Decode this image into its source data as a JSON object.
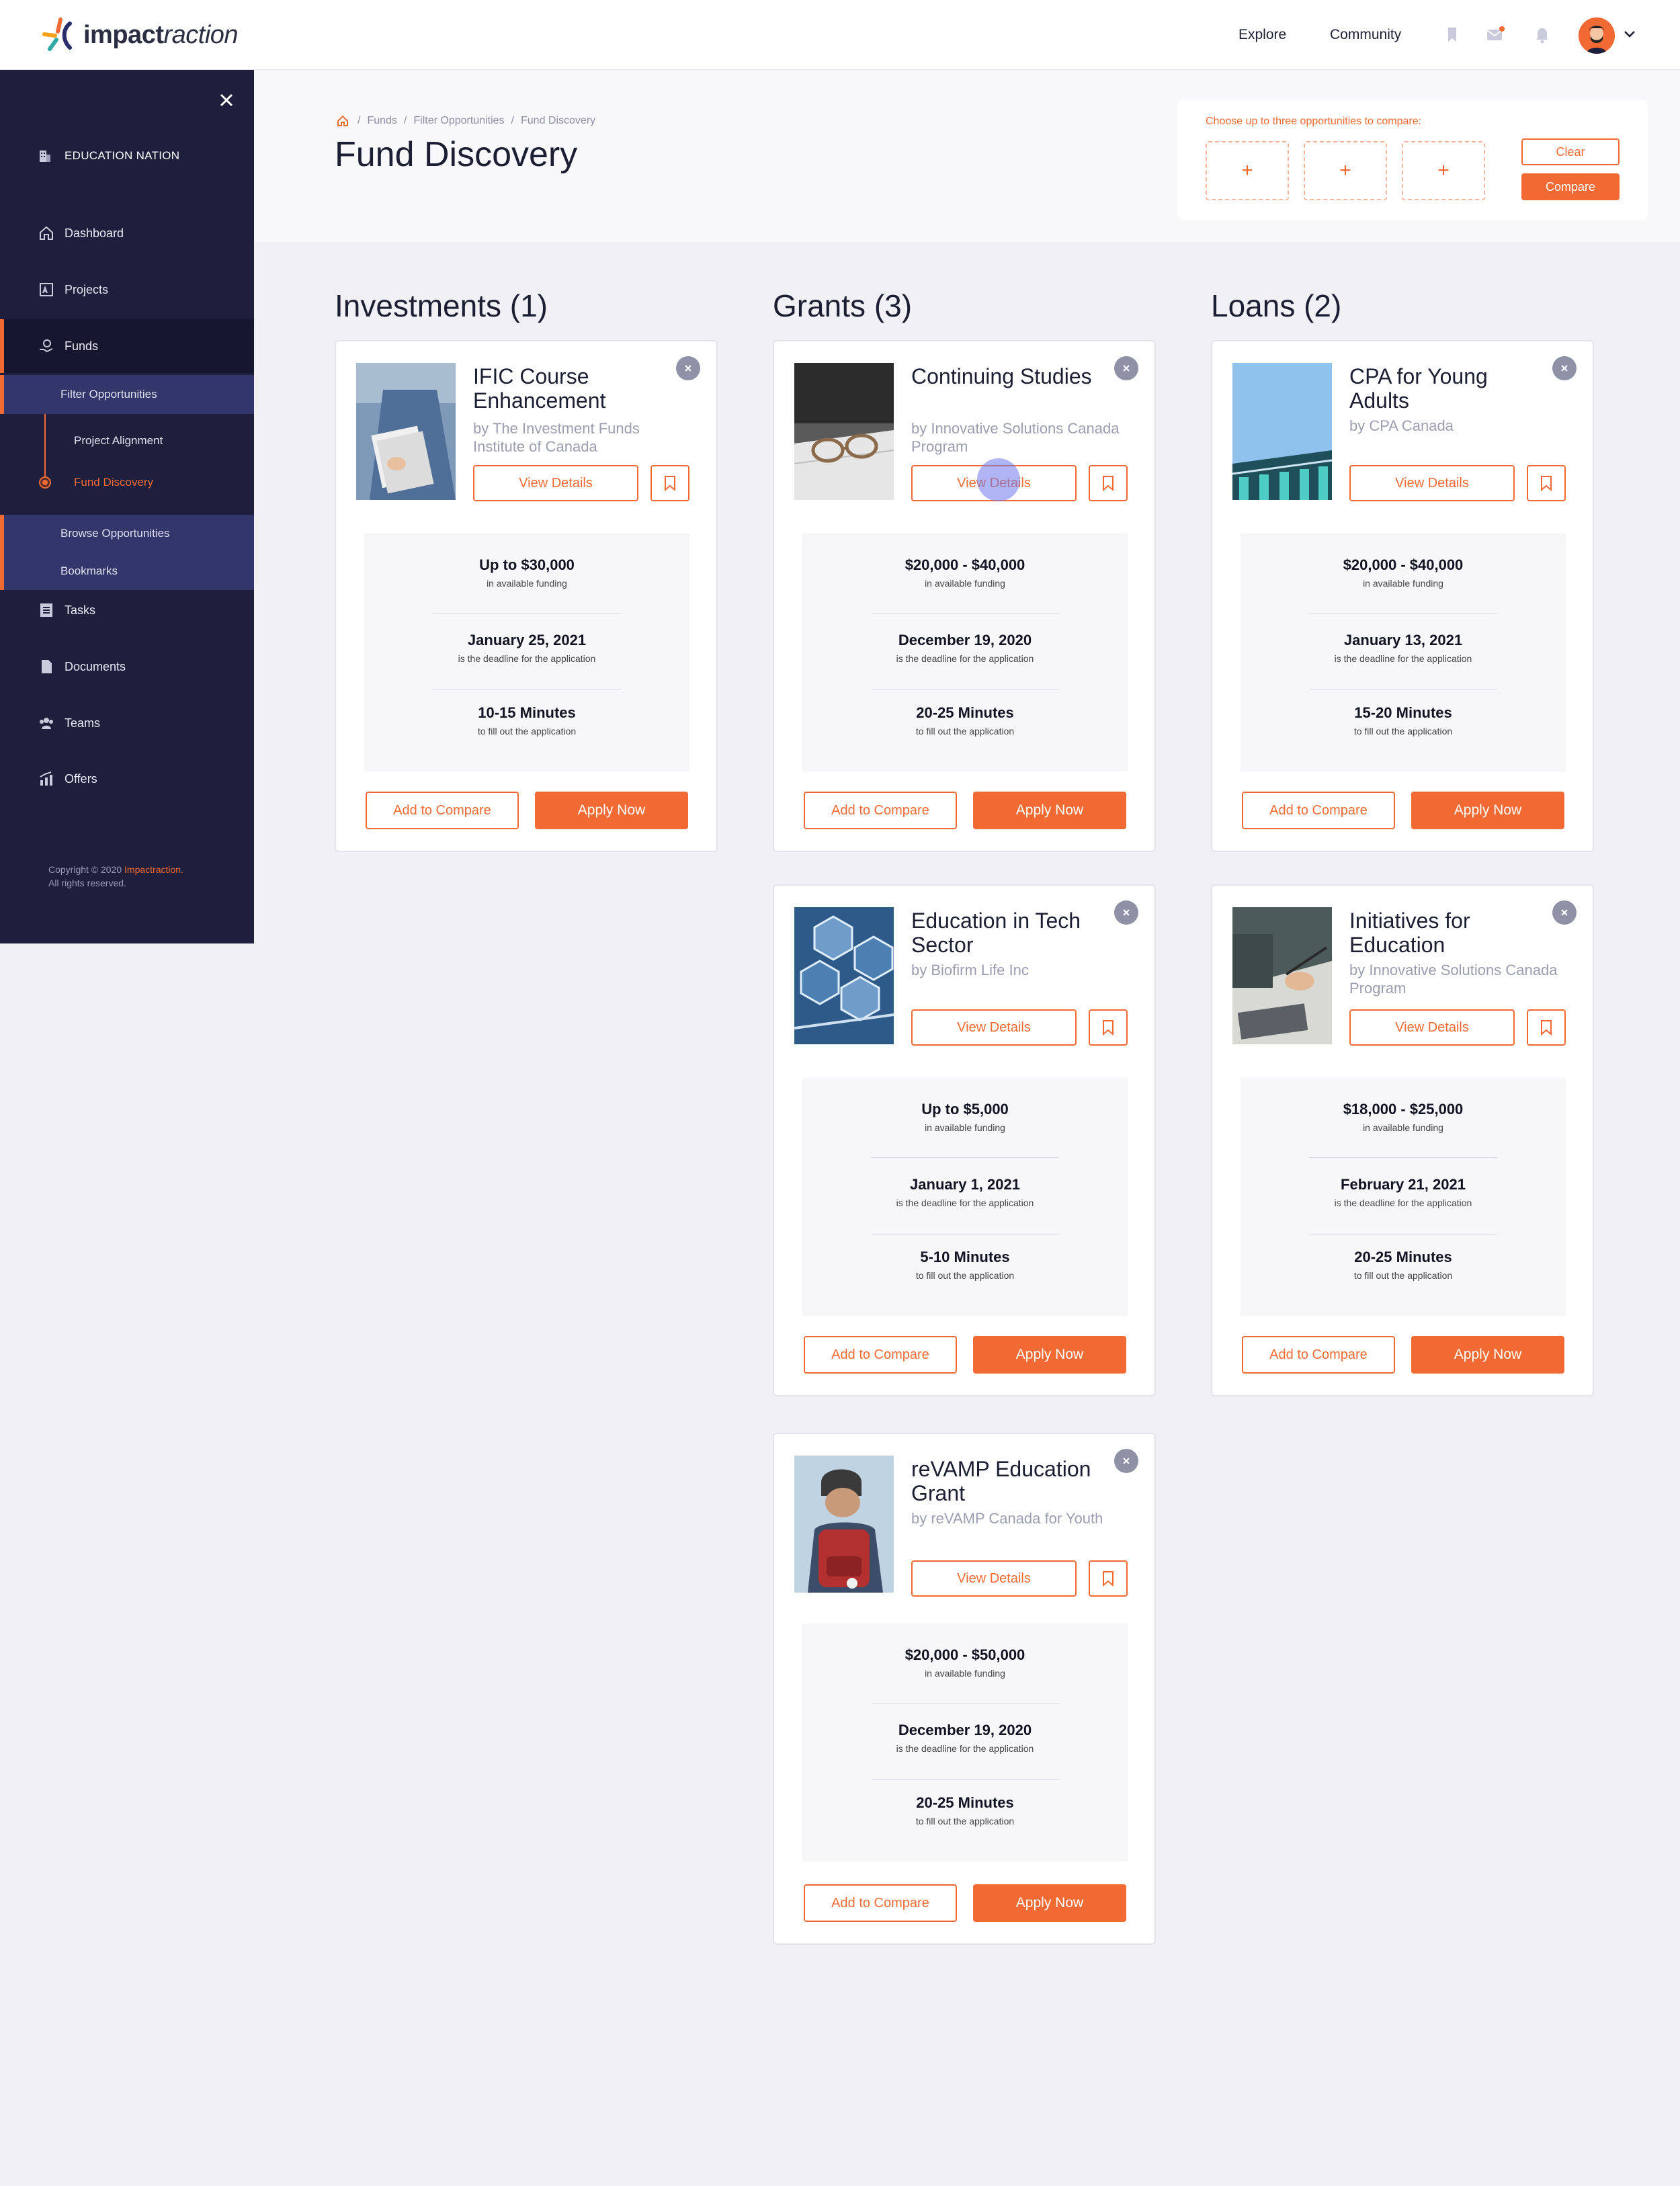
{
  "brand": {
    "bold": "impact",
    "rest": "raction"
  },
  "topnav": {
    "explore": "Explore",
    "community": "Community"
  },
  "sidebar": {
    "org": "EDUCATION NATION",
    "items": {
      "dashboard": "Dashboard",
      "projects": "Projects",
      "funds": "Funds",
      "filter_opportunities": "Filter Opportunities",
      "project_alignment": "Project Alignment",
      "fund_discovery": "Fund Discovery",
      "browse_opportunities": "Browse Opportunities",
      "bookmarks": "Bookmarks",
      "tasks": "Tasks",
      "documents": "Documents",
      "teams": "Teams",
      "offers": "Offers"
    },
    "copyright_prefix": "Copyright © 2020 ",
    "copyright_brand": "Impactraction.",
    "copyright_suffix": "All rights reserved."
  },
  "breadcrumb": {
    "sep": "/",
    "funds": "Funds",
    "filter": "Filter Opportunities",
    "current": "Fund Discovery"
  },
  "page_title": "Fund Discovery",
  "compare": {
    "label": "Choose up to three opportunities to compare:",
    "slot": "+",
    "clear": "Clear",
    "compare": "Compare"
  },
  "columns": {
    "investments": "Investments (1)",
    "grants": "Grants (3)",
    "loans": "Loans (2)"
  },
  "labels": {
    "view_details": "View Details",
    "add_to_compare": "Add to Compare",
    "apply_now": "Apply Now",
    "funding_sub": "in available funding",
    "deadline_sub": "is the deadline for the application",
    "time_sub": "to fill out the application"
  },
  "cards": [
    {
      "title": "IFIC Course Enhancement",
      "by": "by The Investment Funds Institute of Canada",
      "funding": "Up to $30,000",
      "deadline": "January 25, 2021",
      "time": "10-15 Minutes"
    },
    {
      "title": "Continuing Studies",
      "by": "by Innovative Solutions Canada Program",
      "funding": "$20,000 - $40,000",
      "deadline": "December 19, 2020",
      "time": "20-25 Minutes"
    },
    {
      "title": "CPA for Young Adults",
      "by": "by CPA Canada",
      "funding": "$20,000 - $40,000",
      "deadline": "January 13, 2021",
      "time": "15-20 Minutes"
    },
    {
      "title": "Education in Tech Sector",
      "by": "by Biofirm Life Inc",
      "funding": "Up to $5,000",
      "deadline": "January 1, 2021",
      "time": "5-10 Minutes"
    },
    {
      "title": "Initiatives for Education",
      "by": "by Innovative Solutions Canada Program",
      "funding": "$18,000 - $25,000",
      "deadline": "February 21, 2021",
      "time": "20-25 Minutes"
    },
    {
      "title": "reVAMP Education Grant",
      "by": "by reVAMP Canada for Youth",
      "funding": "$20,000 - $50,000",
      "deadline": "December 19, 2020",
      "time": "20-25 Minutes"
    }
  ],
  "colors": {
    "accent": "#f26a33",
    "sidebar": "#1e1f3c",
    "sidebar_active": "#33366a",
    "background": "#f0f0f5"
  }
}
